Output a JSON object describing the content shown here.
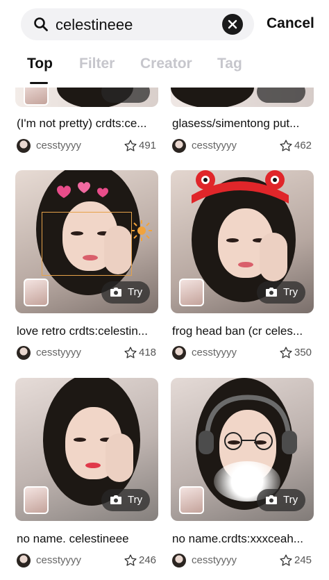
{
  "search": {
    "query": "celestineee",
    "cancel_label": "Cancel"
  },
  "tabs": [
    {
      "label": "Top",
      "active": true
    },
    {
      "label": "Filter",
      "active": false
    },
    {
      "label": "Creator",
      "active": false
    },
    {
      "label": "Tag",
      "active": false
    }
  ],
  "try_label": "Try",
  "results": [
    {
      "caption": "(I'm not pretty) crdts:ce...",
      "user": "cesstyyyy",
      "likes": "491"
    },
    {
      "caption": "glasess/simentong put...",
      "user": "cesstyyyy",
      "likes": "462"
    },
    {
      "caption": "love retro crdts:celestin...",
      "user": "cesstyyyy",
      "likes": "418"
    },
    {
      "caption": "frog head ban (cr celes...",
      "user": "cesstyyyy",
      "likes": "350"
    },
    {
      "caption": "no name. celestineee",
      "user": "cesstyyyy",
      "likes": "246"
    },
    {
      "caption": "no name.crdts:xxxceah...",
      "user": "cesstyyyy",
      "likes": "245"
    }
  ]
}
